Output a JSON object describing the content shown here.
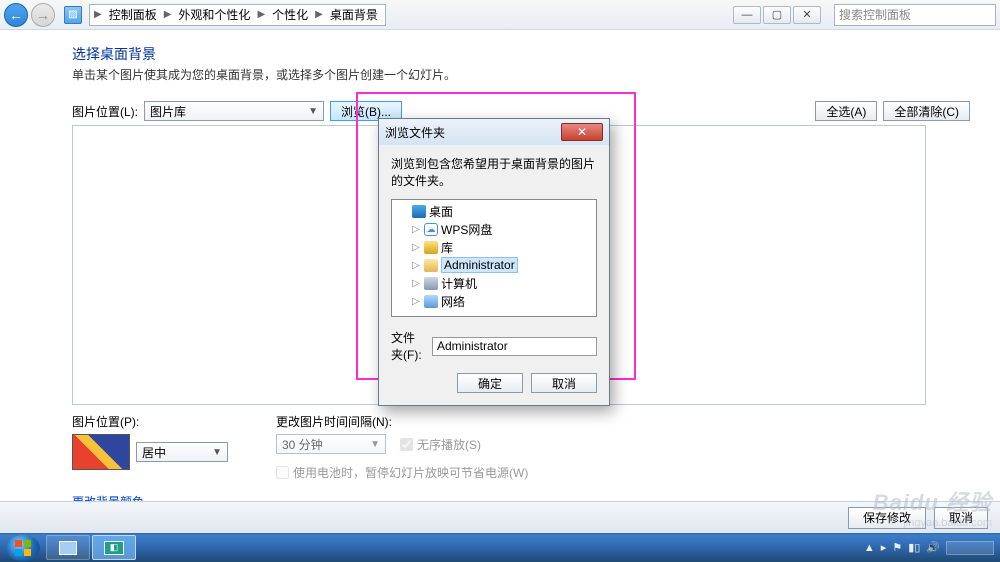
{
  "win_controls": {
    "min": "—",
    "max": "▢",
    "close": "✕"
  },
  "breadcrumb": {
    "items": [
      "控制面板",
      "外观和个性化",
      "个性化",
      "桌面背景"
    ]
  },
  "search": {
    "placeholder": "搜索控制面板"
  },
  "page": {
    "title": "选择桌面背景",
    "subtitle": "单击某个图片使其成为您的桌面背景，或选择多个图片创建一个幻灯片。"
  },
  "picloc": {
    "label": "图片位置(L):",
    "value": "图片库",
    "browse": "浏览(B)...",
    "select_all": "全选(A)",
    "clear_all": "全部清除(C)"
  },
  "bottom": {
    "pos_label": "图片位置(P):",
    "pos_value": "居中",
    "interval_label": "更改图片时间间隔(N):",
    "interval_value": "30 分钟",
    "shuffle": "无序播放(S)",
    "battery": "使用电池时，暂停幻灯片放映可节省电源(W)",
    "link": "更改背景颜色"
  },
  "footer": {
    "save": "保存修改",
    "cancel": "取消"
  },
  "dialog": {
    "title": "浏览文件夹",
    "message": "浏览到包含您希望用于桌面背景的图片的文件夹。",
    "tree": {
      "desktop": "桌面",
      "wps": "WPS网盘",
      "lib": "库",
      "admin": "Administrator",
      "computer": "计算机",
      "network": "网络"
    },
    "folder_label": "文件夹(F):",
    "folder_value": "Administrator",
    "ok": "确定",
    "cancel": "取消"
  },
  "watermark": {
    "brand": "Baidu 经验",
    "url": "jingyan.baidu.com"
  }
}
